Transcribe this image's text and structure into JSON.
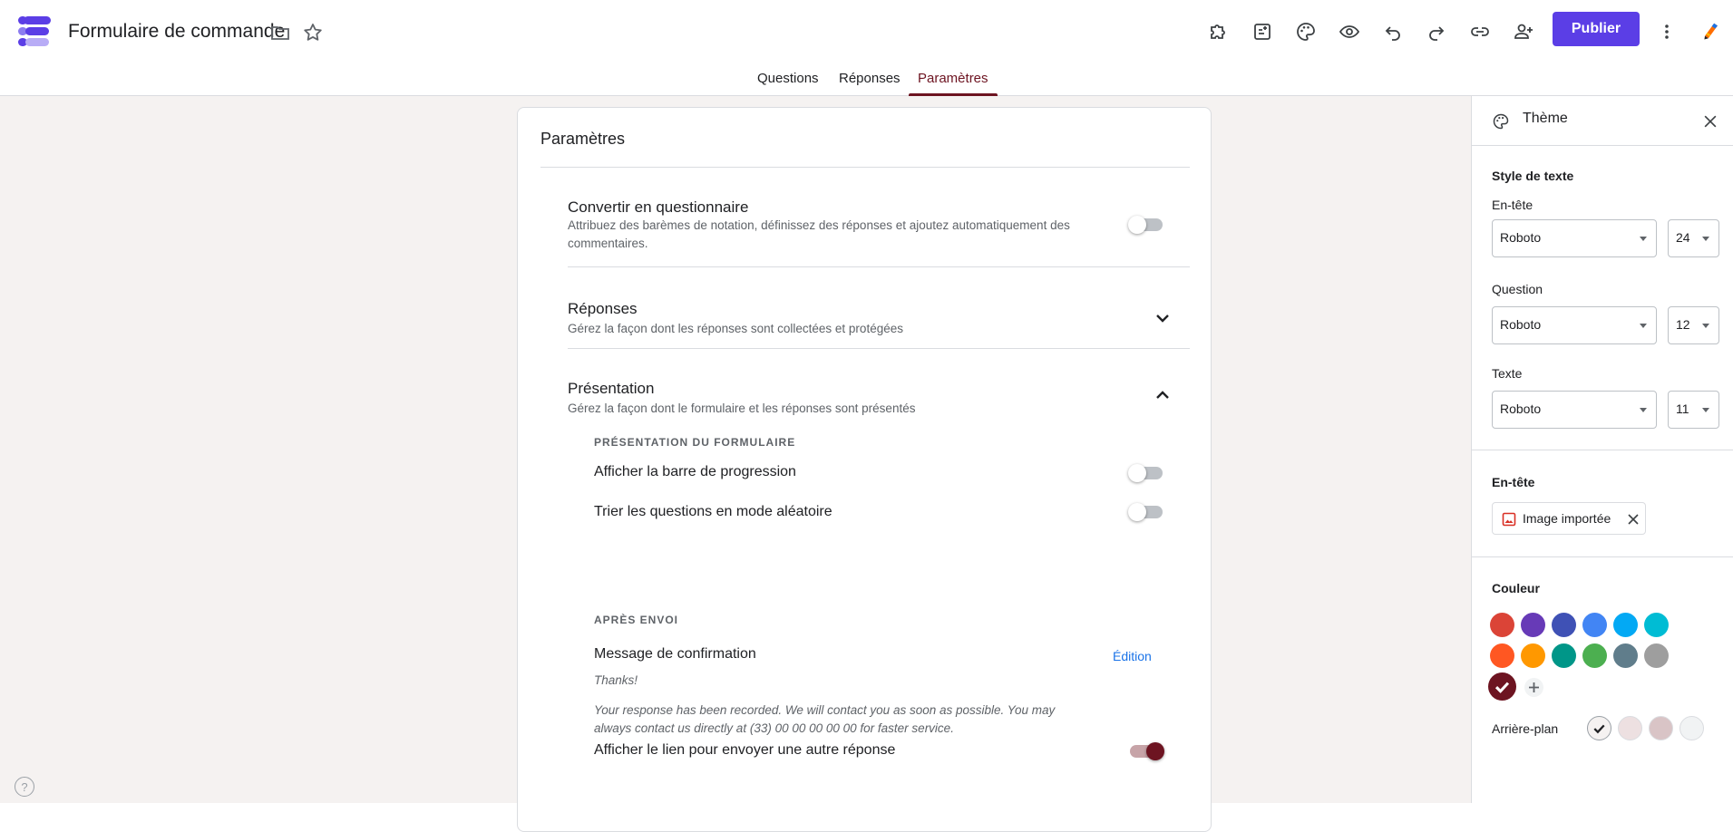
{
  "header": {
    "title": "Formulaire de commande",
    "publish_label": "Publier"
  },
  "tabs": [
    {
      "label": "Questions",
      "active": false
    },
    {
      "label": "Réponses",
      "active": false
    },
    {
      "label": "Paramètres",
      "active": true
    }
  ],
  "settings": {
    "title": "Paramètres",
    "quiz": {
      "title": "Convertir en questionnaire",
      "description": "Attribuez des barèmes de notation, définissez des réponses et ajoutez automatiquement des commentaires.",
      "enabled": false
    },
    "responses": {
      "title": "Réponses",
      "description": "Gérez la façon dont les réponses sont collectées et protégées"
    },
    "presentation": {
      "title": "Présentation",
      "description": "Gérez la façon dont le formulaire et les réponses sont présentés",
      "form_section_label": "PRÉSENTATION DU FORMULAIRE",
      "progress_bar": {
        "label": "Afficher la barre de progression",
        "enabled": false
      },
      "shuffle": {
        "label": "Trier les questions en mode aléatoire",
        "enabled": false
      },
      "after_submit_label": "APRÈS ENVOI",
      "confirmation": {
        "label": "Message de confirmation",
        "edit_label": "Édition",
        "message_line1": "Thanks!",
        "message_line2": "Your response has been recorded. We will contact you as soon as possible. You may always contact us directly at (33) 00 00 00 00 00 for faster service."
      },
      "another_response": {
        "label": "Afficher le lien pour envoyer une autre réponse",
        "enabled": true
      }
    }
  },
  "theme_panel": {
    "title": "Thème",
    "text_style_label": "Style de texte",
    "header_label": "En-tête",
    "header_font": "Roboto",
    "header_size": "24",
    "question_label": "Question",
    "question_font": "Roboto",
    "question_size": "12",
    "text_label": "Texte",
    "text_font": "Roboto",
    "text_size": "11",
    "header_section_label": "En-tête",
    "header_image_label": "Image importée",
    "color_label": "Couleur",
    "colors": [
      "#db4437",
      "#673ab7",
      "#3f51b5",
      "#4285f4",
      "#03a9f4",
      "#00bcd4",
      "#ff5722",
      "#ff9800",
      "#009688",
      "#4caf50",
      "#607d8b",
      "#9e9e9e",
      "#6d1421"
    ],
    "selected_color": "#6d1421",
    "background_label": "Arrière-plan",
    "backgrounds": [
      "#f5f2f1",
      "#ede0e1",
      "#d9c4c6",
      "#f1f3f4"
    ]
  }
}
